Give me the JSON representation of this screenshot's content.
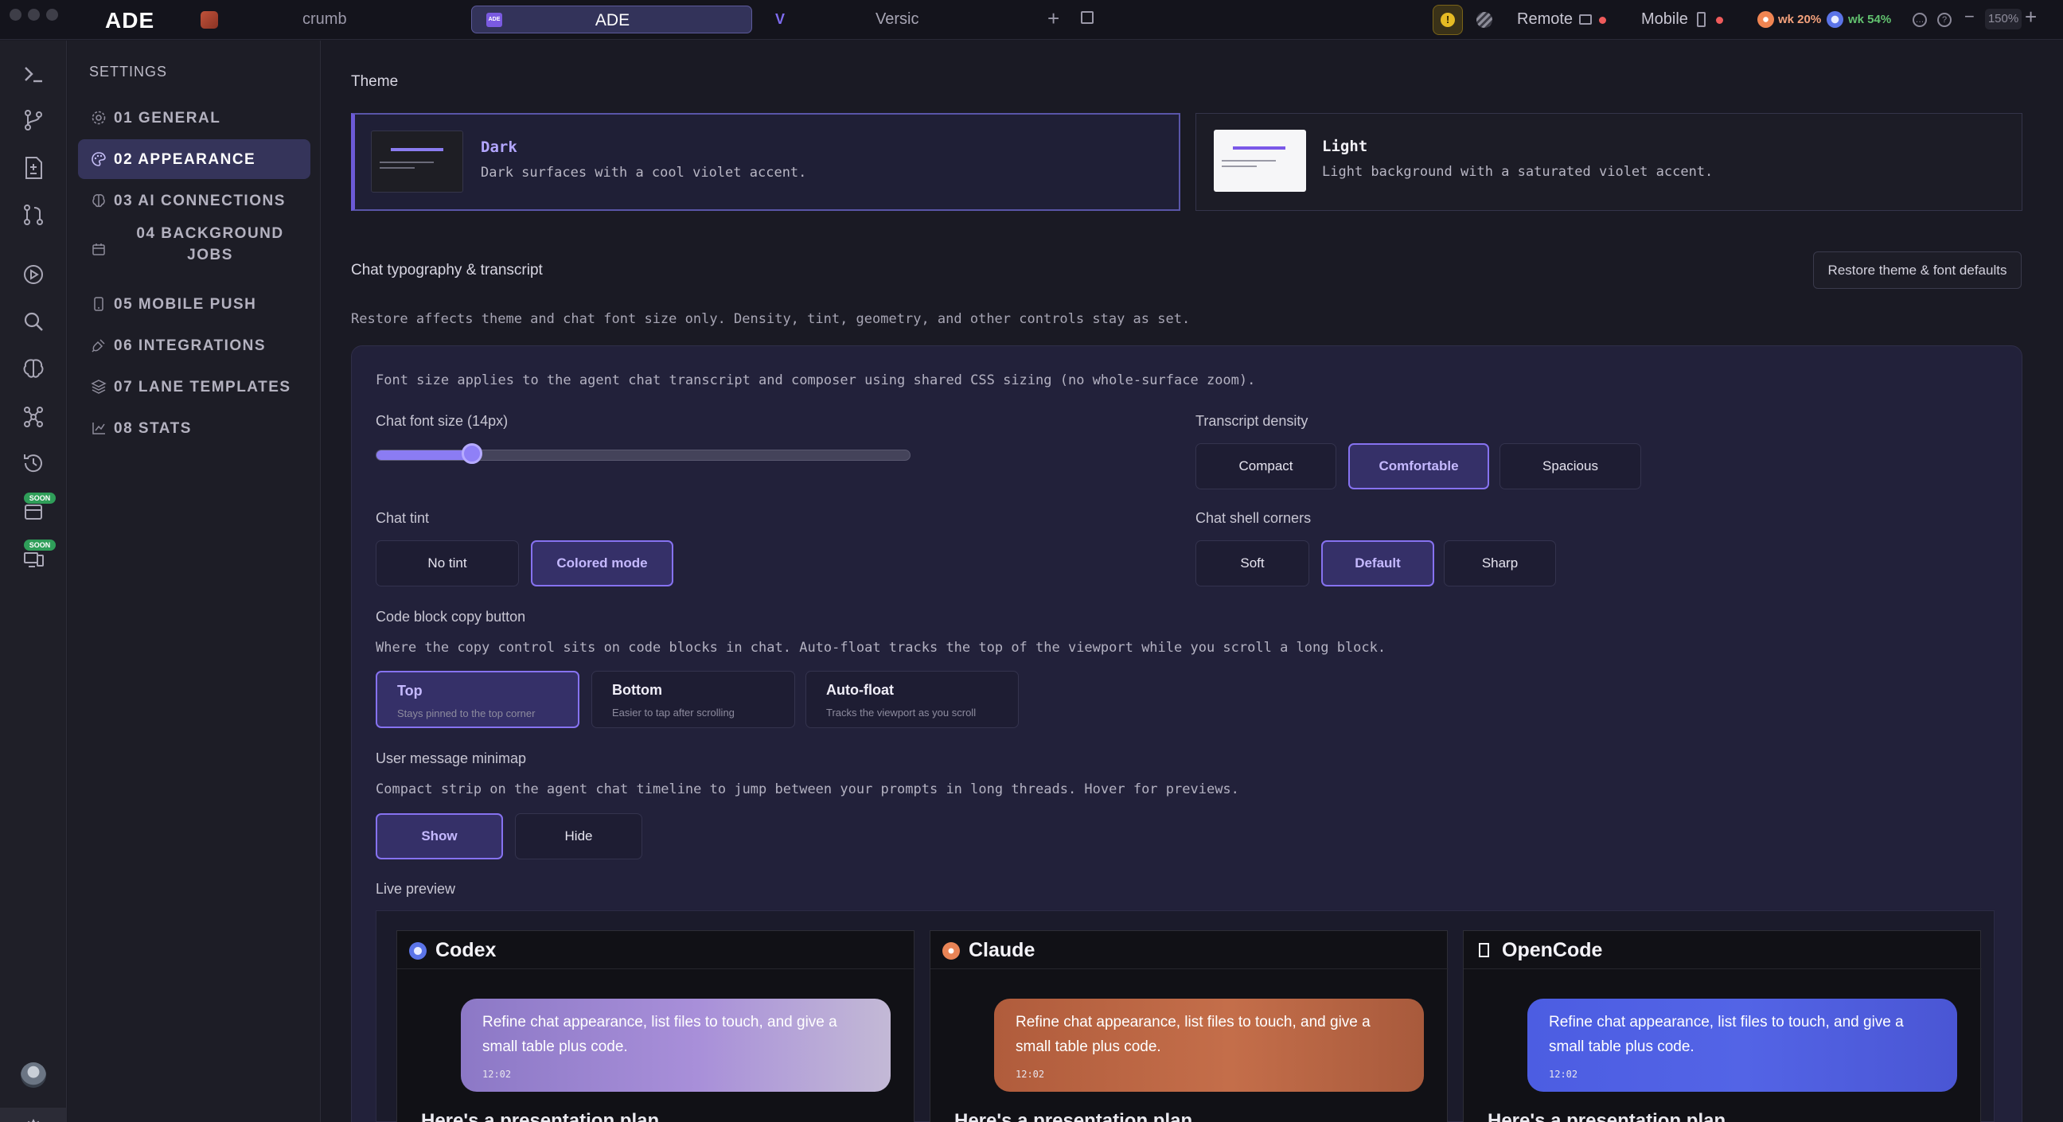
{
  "titlebar": {
    "brand": "ADE",
    "crumb": "crumb",
    "tabs": [
      {
        "label": "ADE",
        "icon_text": "ADE",
        "active": true
      },
      {
        "label": "Versic",
        "active": false
      }
    ],
    "remote_label": "Remote",
    "mobile_label": "Mobile",
    "usage": [
      {
        "label": "wk 20%",
        "color": "#f5a27c"
      },
      {
        "label": "wk 54%",
        "color": "#62c26f"
      }
    ],
    "zoom": "150%"
  },
  "settings_nav": {
    "heading": "SETTINGS",
    "items": [
      {
        "label": "01 GENERAL",
        "icon": "gear-icon"
      },
      {
        "label": "02 APPEARANCE",
        "icon": "palette-icon",
        "active": true
      },
      {
        "label": "03 AI CONNECTIONS",
        "icon": "brain-icon"
      },
      {
        "label_line1": "04 BACKGROUND",
        "label_line2": "JOBS",
        "icon": "calendar-icon"
      },
      {
        "label": "05 MOBILE PUSH",
        "icon": "phone-icon"
      },
      {
        "label": "06 INTEGRATIONS",
        "icon": "plug-icon"
      },
      {
        "label": "07 LANE TEMPLATES",
        "icon": "layers-icon"
      },
      {
        "label": "08 STATS",
        "icon": "chart-icon"
      }
    ]
  },
  "rail": {
    "soon_badges": [
      "SOON",
      "SOON"
    ]
  },
  "theme": {
    "heading": "Theme",
    "options": [
      {
        "name": "Dark",
        "description": "Dark surfaces with a cool violet accent.",
        "selected": true
      },
      {
        "name": "Light",
        "description": "Light background with a saturated violet accent.",
        "selected": false
      }
    ]
  },
  "typography": {
    "heading": "Chat typography & transcript",
    "restore_button": "Restore theme & font defaults",
    "restore_note": "Restore affects theme and chat font size only. Density, tint, geometry, and other controls stay as set.",
    "font_note": "Font size applies to the agent chat transcript and composer using shared CSS sizing (no whole-surface zoom).",
    "font_size_label": "Chat font size (14px)",
    "font_size_fraction": 0.18,
    "density": {
      "label": "Transcript density",
      "options": [
        "Compact",
        "Comfortable",
        "Spacious"
      ],
      "selected": "Comfortable"
    },
    "tint": {
      "label": "Chat tint",
      "options": [
        "No tint",
        "Colored mode"
      ],
      "selected": "Colored mode"
    },
    "corners": {
      "label": "Chat shell corners",
      "options": [
        "Soft",
        "Default",
        "Sharp"
      ],
      "selected": "Default"
    },
    "copy_button": {
      "label": "Code block copy button",
      "description": "Where the copy control sits on code blocks in chat. Auto-float tracks the top of the viewport while you scroll a long block.",
      "options": [
        {
          "title": "Top",
          "subtitle": "Stays pinned to the top corner"
        },
        {
          "title": "Bottom",
          "subtitle": "Easier to tap after scrolling"
        },
        {
          "title": "Auto-float",
          "subtitle": "Tracks the viewport as you scroll"
        }
      ],
      "selected": "Top"
    },
    "minimap": {
      "label": "User message minimap",
      "description": "Compact strip on the agent chat timeline to jump between your prompts in long threads. Hover for previews.",
      "options": [
        "Show",
        "Hide"
      ],
      "selected": "Show"
    },
    "live_preview": {
      "label": "Live preview",
      "cards": [
        {
          "name": "Codex",
          "message": "Refine chat appearance, list files to touch, and give a small table plus code.",
          "time": "12:02"
        },
        {
          "name": "Claude",
          "message": "Refine chat appearance, list files to touch, and give a small table plus code.",
          "time": "12:02"
        },
        {
          "name": "OpenCode",
          "message": "Refine chat appearance, list files to touch, and give a small table plus code.",
          "time": "12:02"
        }
      ],
      "partial_reply": "Here's a presentation plan"
    }
  }
}
